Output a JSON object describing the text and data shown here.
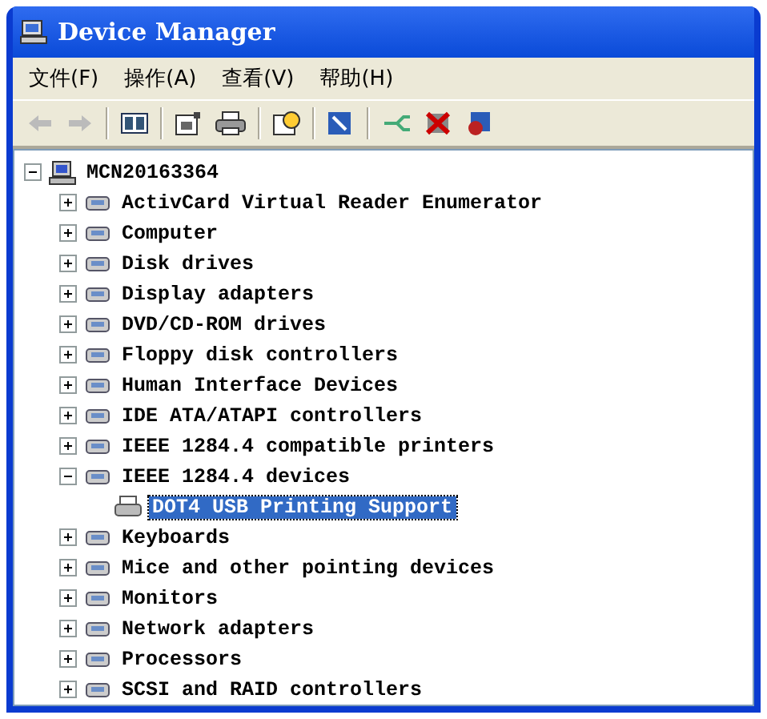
{
  "window": {
    "title": "Device Manager"
  },
  "menu": [
    {
      "label": "文件(F)"
    },
    {
      "label": "操作(A)"
    },
    {
      "label": "查看(V)"
    },
    {
      "label": "帮助(H)"
    }
  ],
  "tree": {
    "root": {
      "label": "MCN20163364",
      "expanded": true,
      "selected": false,
      "children": [
        {
          "label": "ActivCard Virtual Reader Enumerator",
          "expanded": false,
          "selected": false
        },
        {
          "label": "Computer",
          "expanded": false,
          "selected": false
        },
        {
          "label": "Disk drives",
          "expanded": false,
          "selected": false
        },
        {
          "label": "Display adapters",
          "expanded": false,
          "selected": false
        },
        {
          "label": "DVD/CD-ROM drives",
          "expanded": false,
          "selected": false
        },
        {
          "label": "Floppy disk controllers",
          "expanded": false,
          "selected": false
        },
        {
          "label": "Human Interface Devices",
          "expanded": false,
          "selected": false
        },
        {
          "label": "IDE ATA/ATAPI controllers",
          "expanded": false,
          "selected": false
        },
        {
          "label": "IEEE 1284.4 compatible printers",
          "expanded": false,
          "selected": false
        },
        {
          "label": "IEEE 1284.4 devices",
          "expanded": true,
          "selected": false,
          "children": [
            {
              "label": "DOT4 USB Printing Support",
              "selected": true
            }
          ]
        },
        {
          "label": "Keyboards",
          "expanded": false,
          "selected": false
        },
        {
          "label": "Mice and other pointing devices",
          "expanded": false,
          "selected": false
        },
        {
          "label": "Monitors",
          "expanded": false,
          "selected": false
        },
        {
          "label": "Network adapters",
          "expanded": false,
          "selected": false
        },
        {
          "label": "Processors",
          "expanded": false,
          "selected": false
        },
        {
          "label": "SCSI and RAID controllers",
          "expanded": false,
          "selected": false
        }
      ]
    }
  }
}
